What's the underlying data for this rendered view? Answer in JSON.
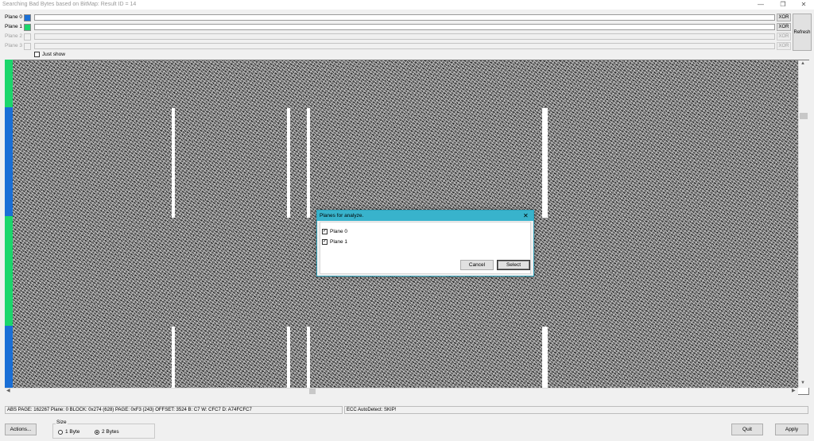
{
  "window": {
    "title": "Searching Bad Bytes based on BitMap: Result ID = 14",
    "minimize_glyph": "—",
    "restore_glyph": "❐",
    "close_glyph": "✕"
  },
  "planes": [
    {
      "label": "Plane 0",
      "color": "#1a6fd6",
      "enabled": true,
      "xor": "XOR"
    },
    {
      "label": "Plane 1",
      "color": "#1bd66b",
      "enabled": true,
      "xor": "XOR"
    },
    {
      "label": "Plane 2",
      "color": "#f0f0f0",
      "enabled": false,
      "xor": "XOR"
    },
    {
      "label": "Plane 3",
      "color": "#f0f0f0",
      "enabled": false,
      "xor": "XOR"
    }
  ],
  "refresh_label": "Refresh",
  "just_show_label": "Just show",
  "strip_colors": {
    "plane0": "#1a6fd6",
    "plane1": "#1bd66b"
  },
  "status": {
    "left": "ABS PAGE: 162267    Plane: 0    BLOCK: 0x274 (628)    PAGE: 0xF3 (243)    OFFSET: 3524    B: C7 W: CFC7 D: A74FCFC7",
    "right": "ECC AutoDetect: SKIP!"
  },
  "buttons": {
    "actions": "Actions...",
    "quit": "Quit",
    "apply": "Apply"
  },
  "size_group": {
    "title": "Size",
    "options": [
      {
        "label": "1 Byte",
        "selected": false
      },
      {
        "label": "2 Bytes",
        "selected": true
      }
    ]
  },
  "dialog": {
    "title": "Planes for analyze.",
    "close_glyph": "✕",
    "items": [
      {
        "label": "Plane 0",
        "checked": true
      },
      {
        "label": "Plane 1",
        "checked": true
      }
    ],
    "cancel_label": "Cancel",
    "select_label": "Select"
  },
  "scroll_arrows": {
    "left": "◀",
    "right": "▶",
    "up": "▲",
    "down": "▼"
  },
  "check_glyph": "✓"
}
